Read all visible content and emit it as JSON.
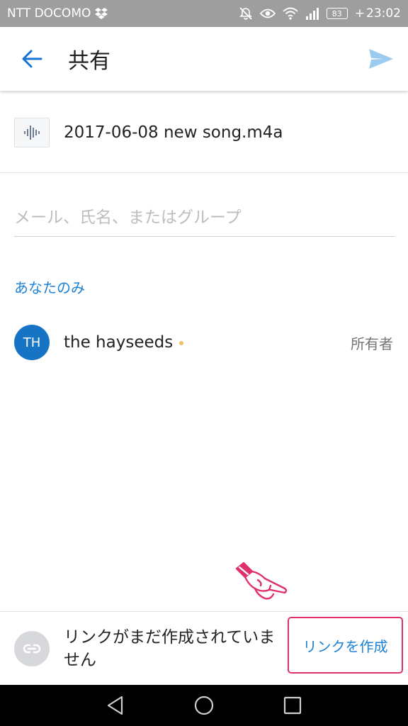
{
  "status_bar": {
    "carrier": "NTT DOCOMO",
    "battery": "83",
    "time": "23:02"
  },
  "app_bar": {
    "title": "共有"
  },
  "file": {
    "name": "2017-06-08 new song.m4a"
  },
  "recipient_input": {
    "placeholder": "メール、氏名、またはグループ",
    "value": ""
  },
  "section": {
    "label": "あなたのみ"
  },
  "members": [
    {
      "initials": "TH",
      "name": "the hayseeds",
      "role": "所有者"
    }
  ],
  "link_bar": {
    "status": "リンクがまだ作成されていません",
    "button_label": "リンクを作成"
  },
  "colors": {
    "accent": "#1d82d6",
    "avatar": "#1774c4",
    "highlight": "#e0306c",
    "status_bar": "#9e9e9e",
    "send_disabled": "#9ccbf0"
  },
  "icons": {
    "status": [
      "dropbox-icon",
      "mute-icon",
      "eye-icon",
      "wifi-icon",
      "signal-icon",
      "battery-icon",
      "charging-icon"
    ],
    "app_bar": [
      "back-arrow-icon",
      "send-icon"
    ],
    "file": "audio-waveform-icon",
    "link": "link-icon",
    "nav": [
      "nav-back-icon",
      "nav-home-icon",
      "nav-recents-icon"
    ]
  }
}
